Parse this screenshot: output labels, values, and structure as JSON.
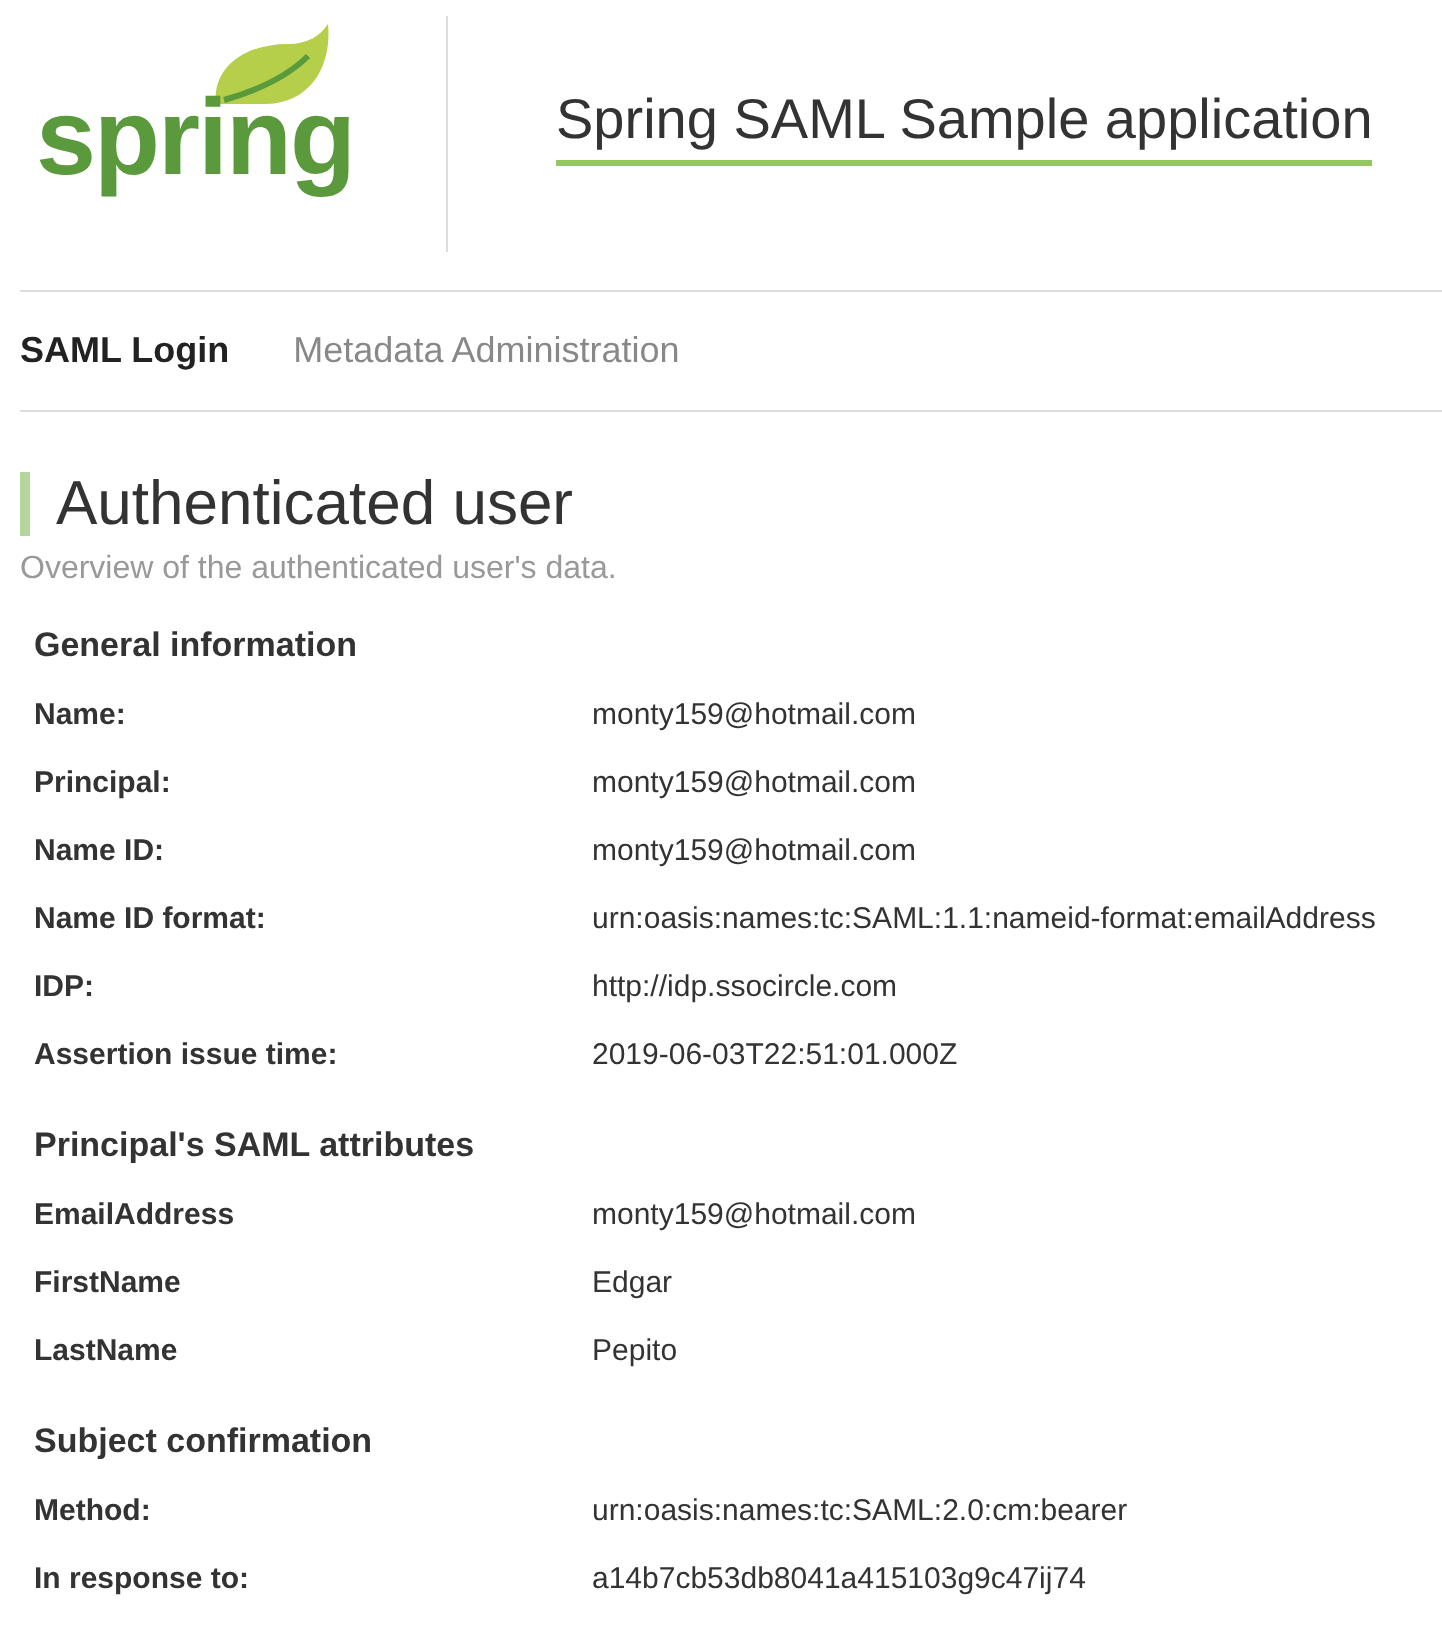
{
  "logo": {
    "text": "spring"
  },
  "header": {
    "title": "Spring SAML Sample application"
  },
  "nav": [
    {
      "label": "SAML Login",
      "selected": true
    },
    {
      "label": "Metadata Administration",
      "selected": false
    }
  ],
  "page": {
    "title": "Authenticated user",
    "subtitle": "Overview of the authenticated user's data."
  },
  "sections": [
    {
      "title": "General information",
      "rows": [
        {
          "label": "Name:",
          "value": "monty159@hotmail.com"
        },
        {
          "label": "Principal:",
          "value": "monty159@hotmail.com"
        },
        {
          "label": "Name ID:",
          "value": "monty159@hotmail.com"
        },
        {
          "label": "Name ID format:",
          "value": "urn:oasis:names:tc:SAML:1.1:nameid-format:emailAddress"
        },
        {
          "label": "IDP:",
          "value": "http://idp.ssocircle.com"
        },
        {
          "label": "Assertion issue time:",
          "value": "2019-06-03T22:51:01.000Z"
        }
      ]
    },
    {
      "title": "Principal's SAML attributes",
      "rows": [
        {
          "label": "EmailAddress",
          "value": "monty159@hotmail.com"
        },
        {
          "label": "FirstName",
          "value": "Edgar"
        },
        {
          "label": "LastName",
          "value": "Pepito"
        }
      ]
    },
    {
      "title": "Subject confirmation",
      "rows": [
        {
          "label": "Method:",
          "value": "urn:oasis:names:tc:SAML:2.0:cm:bearer"
        },
        {
          "label": "In response to:",
          "value": "a14b7cb53db8041a415103g9c47ij74"
        }
      ]
    }
  ]
}
